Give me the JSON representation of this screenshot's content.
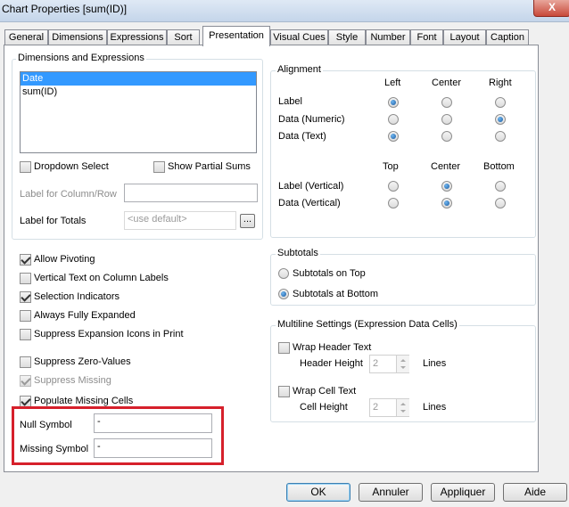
{
  "window": {
    "title": "Chart Properties [sum(ID)]",
    "close_label": "X"
  },
  "tabs": [
    {
      "label": "General"
    },
    {
      "label": "Dimensions"
    },
    {
      "label": "Expressions"
    },
    {
      "label": "Sort"
    },
    {
      "label": "Presentation"
    },
    {
      "label": "Visual Cues"
    },
    {
      "label": "Style"
    },
    {
      "label": "Number"
    },
    {
      "label": "Font"
    },
    {
      "label": "Layout"
    },
    {
      "label": "Caption"
    }
  ],
  "dims": {
    "group_label": "Dimensions and Expressions",
    "items": [
      "Date",
      "sum(ID)"
    ],
    "dropdown_select": "Dropdown Select",
    "show_partial_sums": "Show Partial Sums",
    "label_column_row": "Label for Column/Row",
    "label_column_row_value": "",
    "label_totals": "Label for Totals",
    "label_totals_value": "<use default>",
    "browse": "..."
  },
  "alignment": {
    "group_label": "Alignment",
    "col_left": "Left",
    "col_center": "Center",
    "col_right": "Right",
    "row_label": "Label",
    "row_numeric": "Data (Numeric)",
    "row_text": "Data (Text)",
    "col_top": "Top",
    "col_vcenter": "Center",
    "col_bottom": "Bottom",
    "row_label_v": "Label (Vertical)",
    "row_data_v": "Data (Vertical)"
  },
  "options": {
    "allow_pivoting": "Allow Pivoting",
    "vertical_text": "Vertical Text on Column Labels",
    "selection_indicators": "Selection Indicators",
    "always_expanded": "Always Fully Expanded",
    "suppress_icons": "Suppress Expansion Icons in Print",
    "suppress_zero": "Suppress Zero-Values",
    "suppress_missing": "Suppress Missing",
    "populate_missing": "Populate Missing Cells",
    "null_symbol": "Null Symbol",
    "null_symbol_value": "-",
    "missing_symbol": "Missing Symbol",
    "missing_symbol_value": "-"
  },
  "subtotals": {
    "group_label": "Subtotals",
    "on_top": "Subtotals on Top",
    "at_bottom": "Subtotals at Bottom"
  },
  "multiline": {
    "group_label": "Multiline Settings (Expression Data Cells)",
    "wrap_header": "Wrap Header Text",
    "header_height": "Header Height",
    "header_value": "2",
    "lines1": "Lines",
    "wrap_cell": "Wrap Cell Text",
    "cell_height": "Cell Height",
    "cell_value": "2",
    "lines2": "Lines"
  },
  "buttons": {
    "ok": "OK",
    "cancel": "Annuler",
    "apply": "Appliquer",
    "help": "Aide"
  },
  "colors": {
    "highlight": "#d6202b",
    "selection": "#3399ff"
  }
}
